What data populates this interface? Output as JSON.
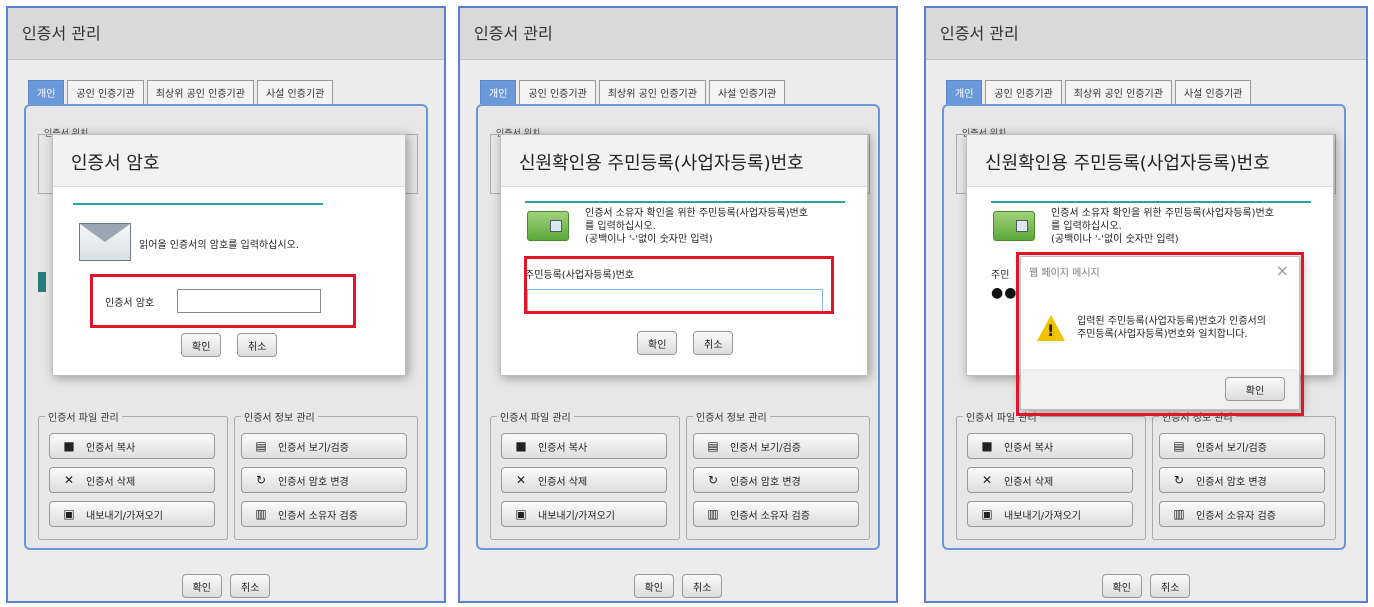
{
  "panels": [
    {
      "title": "인증서 관리",
      "tabs": [
        "개인",
        "공인 인증기관",
        "최상위 공인 인증기관",
        "사설 인증기관"
      ],
      "loc_label": "인증서 위치",
      "file_group": "인증서 파일 관리",
      "info_group": "인증서 정보 관리",
      "file_buttons": [
        "인증서 복사",
        "인증서 삭제",
        "내보내기/가져오기"
      ],
      "info_buttons": [
        "인증서 보기/검증",
        "인증서 암호 변경",
        "인증서 소유자 검증"
      ],
      "ok": "확인",
      "cancel": "취소"
    }
  ],
  "dialog1": {
    "title": "인증서 암호",
    "message": "읽어올 인증서의 암호를 입력하십시오.",
    "field_label": "인증서 암호",
    "field_value": "",
    "ok": "확인",
    "cancel": "취소"
  },
  "dialog2": {
    "title": "신원확인용 주민등록(사업자등록)번호",
    "message1": "인증서 소유자 확인을 위한 주민등록(사업자등록)번호",
    "message2": "를 입력하십시오.",
    "message3": "(공백이나 '-'없이 숫자만 입력)",
    "field_label": "주민등록(사업자등록)번호",
    "field_value": "",
    "ok": "확인",
    "cancel": "취소"
  },
  "dialog3": {
    "title": "신원확인용 주민등록(사업자등록)번호",
    "message1": "인증서 소유자 확인을 위한 주민등록(사업자등록)번호",
    "message2": "를 입력하십시오.",
    "message3": "(공백이나 '-'없이 숫자만 입력)",
    "field_label_partial": "주민",
    "masked_value": "●●",
    "alert": {
      "title": "웹 페이지 메시지",
      "close": "×",
      "message1": "입력된 주민등록(사업자등록)번호가 인증서의",
      "message2": "주민등록(사업자등록)번호와 일치합니다.",
      "ok": "확인"
    }
  },
  "icons": {
    "copy": "■",
    "delete": "✕",
    "export": "▣",
    "view": "▤",
    "password": "↻",
    "owner": "▥"
  },
  "colors": {
    "frame": "#5b7fd4",
    "active_tab": "#6a98d8",
    "highlight": "#e0152a",
    "teal": "#2aa3a3"
  }
}
